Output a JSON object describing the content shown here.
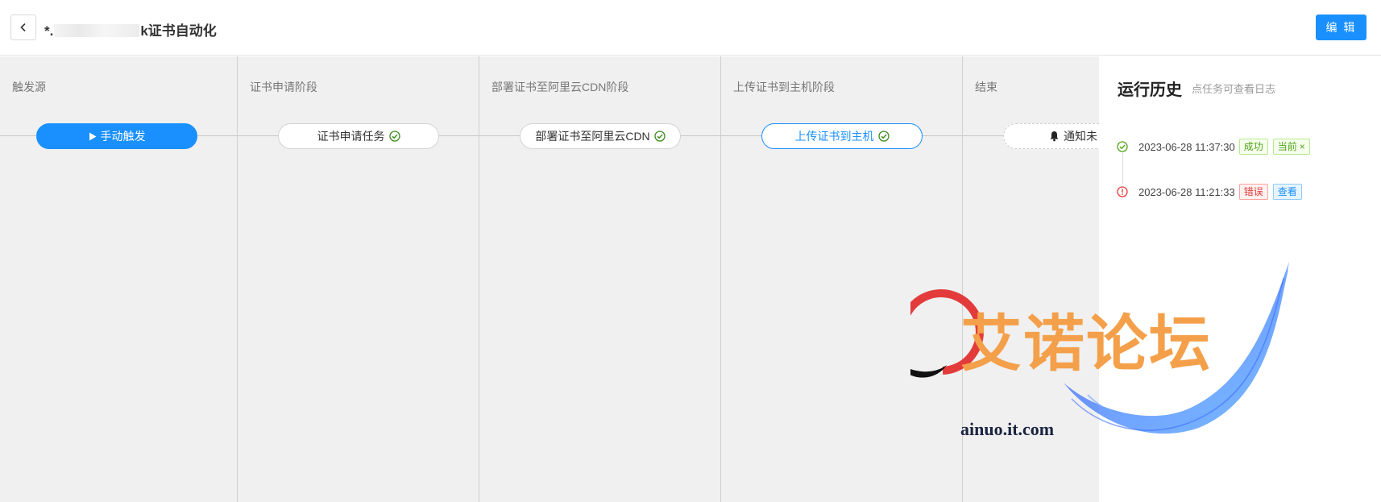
{
  "header": {
    "title_prefix": "*.",
    "title_suffix": "k证书自动化",
    "edit_label": "编 辑"
  },
  "stages": [
    {
      "title": "触发源",
      "node": {
        "label": "手动触发",
        "type": "trigger",
        "icon": "play-icon"
      }
    },
    {
      "title": "证书申请阶段",
      "node": {
        "label": "证书申请任务",
        "type": "task",
        "icon": "check-circle-icon"
      }
    },
    {
      "title": "部署证书至阿里云CDN阶段",
      "node": {
        "label": "部署证书至阿里云CDN",
        "type": "task",
        "icon": "check-circle-icon"
      }
    },
    {
      "title": "上传证书到主机阶段",
      "node": {
        "label": "上传证书到主机",
        "type": "task-active",
        "icon": "check-circle-icon"
      }
    },
    {
      "title": "结束",
      "node": {
        "label": "通知未",
        "type": "end",
        "icon": "bell-icon"
      }
    }
  ],
  "history": {
    "title": "运行历史",
    "subtitle": "点任务可查看日志",
    "items": [
      {
        "time": "2023-06-28 11:37:30",
        "status": "成功",
        "status_type": "success",
        "action": "当前",
        "action_icon": "close-icon"
      },
      {
        "time": "2023-06-28 11:21:33",
        "status": "错误",
        "status_type": "error",
        "action": "查看"
      }
    ]
  },
  "watermark": {
    "text": "艾诺论坛",
    "sub": "ainuo.it.com"
  },
  "colors": {
    "primary": "#1a90ff",
    "success": "#52a41a",
    "error": "#e23b3b",
    "canvas_bg": "#f0f0f0"
  }
}
